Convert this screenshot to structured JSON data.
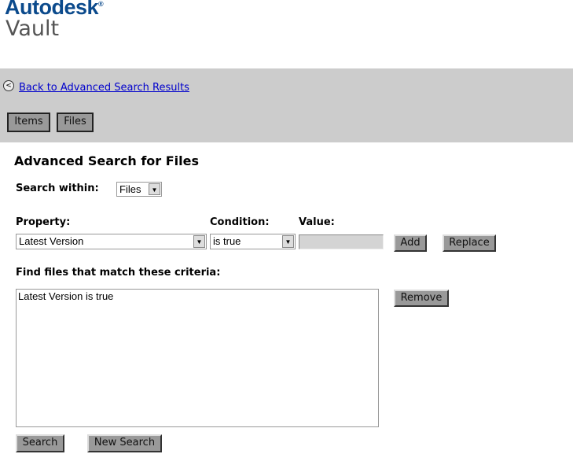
{
  "brand": {
    "name": "Autodesk",
    "product": "Vault"
  },
  "nav": {
    "back_link": "Back to Advanced Search Results",
    "tabs": [
      "Items",
      "Files"
    ]
  },
  "form": {
    "title": "Advanced Search for Files",
    "search_within_label": "Search within:",
    "search_within_value": "Files",
    "property_label": "Property:",
    "property_value": "Latest Version",
    "condition_label": "Condition:",
    "condition_value": "is true",
    "value_label": "Value:",
    "value_value": "",
    "add_label": "Add",
    "replace_label": "Replace",
    "criteria_label": "Find files that match these criteria:",
    "criteria": [
      "Latest Version is true"
    ],
    "remove_label": "Remove",
    "search_label": "Search",
    "new_search_label": "New Search"
  }
}
